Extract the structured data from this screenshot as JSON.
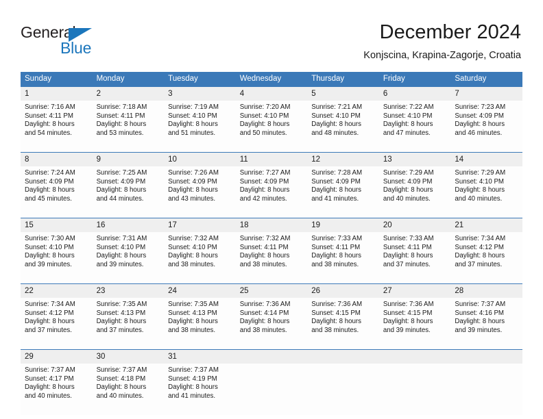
{
  "brand": {
    "name_part1": "General",
    "name_part2": "Blue",
    "accent_color": "#1b76bc",
    "logo_icon": "triangle-icon"
  },
  "header": {
    "title": "December 2024",
    "location": "Konjscina, Krapina-Zagorje, Croatia"
  },
  "calendar": {
    "header_bg": "#3b79b8",
    "daynum_bg": "#efefef",
    "weekday_headers": [
      "Sunday",
      "Monday",
      "Tuesday",
      "Wednesday",
      "Thursday",
      "Friday",
      "Saturday"
    ],
    "weeks": [
      {
        "days": [
          {
            "day": "1",
            "sunrise": "Sunrise: 7:16 AM",
            "sunset": "Sunset: 4:11 PM",
            "daylight_line1": "Daylight: 8 hours",
            "daylight_line2": "and 54 minutes."
          },
          {
            "day": "2",
            "sunrise": "Sunrise: 7:18 AM",
            "sunset": "Sunset: 4:11 PM",
            "daylight_line1": "Daylight: 8 hours",
            "daylight_line2": "and 53 minutes."
          },
          {
            "day": "3",
            "sunrise": "Sunrise: 7:19 AM",
            "sunset": "Sunset: 4:10 PM",
            "daylight_line1": "Daylight: 8 hours",
            "daylight_line2": "and 51 minutes."
          },
          {
            "day": "4",
            "sunrise": "Sunrise: 7:20 AM",
            "sunset": "Sunset: 4:10 PM",
            "daylight_line1": "Daylight: 8 hours",
            "daylight_line2": "and 50 minutes."
          },
          {
            "day": "5",
            "sunrise": "Sunrise: 7:21 AM",
            "sunset": "Sunset: 4:10 PM",
            "daylight_line1": "Daylight: 8 hours",
            "daylight_line2": "and 48 minutes."
          },
          {
            "day": "6",
            "sunrise": "Sunrise: 7:22 AM",
            "sunset": "Sunset: 4:10 PM",
            "daylight_line1": "Daylight: 8 hours",
            "daylight_line2": "and 47 minutes."
          },
          {
            "day": "7",
            "sunrise": "Sunrise: 7:23 AM",
            "sunset": "Sunset: 4:09 PM",
            "daylight_line1": "Daylight: 8 hours",
            "daylight_line2": "and 46 minutes."
          }
        ]
      },
      {
        "days": [
          {
            "day": "8",
            "sunrise": "Sunrise: 7:24 AM",
            "sunset": "Sunset: 4:09 PM",
            "daylight_line1": "Daylight: 8 hours",
            "daylight_line2": "and 45 minutes."
          },
          {
            "day": "9",
            "sunrise": "Sunrise: 7:25 AM",
            "sunset": "Sunset: 4:09 PM",
            "daylight_line1": "Daylight: 8 hours",
            "daylight_line2": "and 44 minutes."
          },
          {
            "day": "10",
            "sunrise": "Sunrise: 7:26 AM",
            "sunset": "Sunset: 4:09 PM",
            "daylight_line1": "Daylight: 8 hours",
            "daylight_line2": "and 43 minutes."
          },
          {
            "day": "11",
            "sunrise": "Sunrise: 7:27 AM",
            "sunset": "Sunset: 4:09 PM",
            "daylight_line1": "Daylight: 8 hours",
            "daylight_line2": "and 42 minutes."
          },
          {
            "day": "12",
            "sunrise": "Sunrise: 7:28 AM",
            "sunset": "Sunset: 4:09 PM",
            "daylight_line1": "Daylight: 8 hours",
            "daylight_line2": "and 41 minutes."
          },
          {
            "day": "13",
            "sunrise": "Sunrise: 7:29 AM",
            "sunset": "Sunset: 4:09 PM",
            "daylight_line1": "Daylight: 8 hours",
            "daylight_line2": "and 40 minutes."
          },
          {
            "day": "14",
            "sunrise": "Sunrise: 7:29 AM",
            "sunset": "Sunset: 4:10 PM",
            "daylight_line1": "Daylight: 8 hours",
            "daylight_line2": "and 40 minutes."
          }
        ]
      },
      {
        "days": [
          {
            "day": "15",
            "sunrise": "Sunrise: 7:30 AM",
            "sunset": "Sunset: 4:10 PM",
            "daylight_line1": "Daylight: 8 hours",
            "daylight_line2": "and 39 minutes."
          },
          {
            "day": "16",
            "sunrise": "Sunrise: 7:31 AM",
            "sunset": "Sunset: 4:10 PM",
            "daylight_line1": "Daylight: 8 hours",
            "daylight_line2": "and 39 minutes."
          },
          {
            "day": "17",
            "sunrise": "Sunrise: 7:32 AM",
            "sunset": "Sunset: 4:10 PM",
            "daylight_line1": "Daylight: 8 hours",
            "daylight_line2": "and 38 minutes."
          },
          {
            "day": "18",
            "sunrise": "Sunrise: 7:32 AM",
            "sunset": "Sunset: 4:11 PM",
            "daylight_line1": "Daylight: 8 hours",
            "daylight_line2": "and 38 minutes."
          },
          {
            "day": "19",
            "sunrise": "Sunrise: 7:33 AM",
            "sunset": "Sunset: 4:11 PM",
            "daylight_line1": "Daylight: 8 hours",
            "daylight_line2": "and 38 minutes."
          },
          {
            "day": "20",
            "sunrise": "Sunrise: 7:33 AM",
            "sunset": "Sunset: 4:11 PM",
            "daylight_line1": "Daylight: 8 hours",
            "daylight_line2": "and 37 minutes."
          },
          {
            "day": "21",
            "sunrise": "Sunrise: 7:34 AM",
            "sunset": "Sunset: 4:12 PM",
            "daylight_line1": "Daylight: 8 hours",
            "daylight_line2": "and 37 minutes."
          }
        ]
      },
      {
        "days": [
          {
            "day": "22",
            "sunrise": "Sunrise: 7:34 AM",
            "sunset": "Sunset: 4:12 PM",
            "daylight_line1": "Daylight: 8 hours",
            "daylight_line2": "and 37 minutes."
          },
          {
            "day": "23",
            "sunrise": "Sunrise: 7:35 AM",
            "sunset": "Sunset: 4:13 PM",
            "daylight_line1": "Daylight: 8 hours",
            "daylight_line2": "and 37 minutes."
          },
          {
            "day": "24",
            "sunrise": "Sunrise: 7:35 AM",
            "sunset": "Sunset: 4:13 PM",
            "daylight_line1": "Daylight: 8 hours",
            "daylight_line2": "and 38 minutes."
          },
          {
            "day": "25",
            "sunrise": "Sunrise: 7:36 AM",
            "sunset": "Sunset: 4:14 PM",
            "daylight_line1": "Daylight: 8 hours",
            "daylight_line2": "and 38 minutes."
          },
          {
            "day": "26",
            "sunrise": "Sunrise: 7:36 AM",
            "sunset": "Sunset: 4:15 PM",
            "daylight_line1": "Daylight: 8 hours",
            "daylight_line2": "and 38 minutes."
          },
          {
            "day": "27",
            "sunrise": "Sunrise: 7:36 AM",
            "sunset": "Sunset: 4:15 PM",
            "daylight_line1": "Daylight: 8 hours",
            "daylight_line2": "and 39 minutes."
          },
          {
            "day": "28",
            "sunrise": "Sunrise: 7:37 AM",
            "sunset": "Sunset: 4:16 PM",
            "daylight_line1": "Daylight: 8 hours",
            "daylight_line2": "and 39 minutes."
          }
        ]
      },
      {
        "days": [
          {
            "day": "29",
            "sunrise": "Sunrise: 7:37 AM",
            "sunset": "Sunset: 4:17 PM",
            "daylight_line1": "Daylight: 8 hours",
            "daylight_line2": "and 40 minutes."
          },
          {
            "day": "30",
            "sunrise": "Sunrise: 7:37 AM",
            "sunset": "Sunset: 4:18 PM",
            "daylight_line1": "Daylight: 8 hours",
            "daylight_line2": "and 40 minutes."
          },
          {
            "day": "31",
            "sunrise": "Sunrise: 7:37 AM",
            "sunset": "Sunset: 4:19 PM",
            "daylight_line1": "Daylight: 8 hours",
            "daylight_line2": "and 41 minutes."
          },
          {
            "day": "",
            "sunrise": "",
            "sunset": "",
            "daylight_line1": "",
            "daylight_line2": ""
          },
          {
            "day": "",
            "sunrise": "",
            "sunset": "",
            "daylight_line1": "",
            "daylight_line2": ""
          },
          {
            "day": "",
            "sunrise": "",
            "sunset": "",
            "daylight_line1": "",
            "daylight_line2": ""
          },
          {
            "day": "",
            "sunrise": "",
            "sunset": "",
            "daylight_line1": "",
            "daylight_line2": ""
          }
        ]
      }
    ]
  }
}
